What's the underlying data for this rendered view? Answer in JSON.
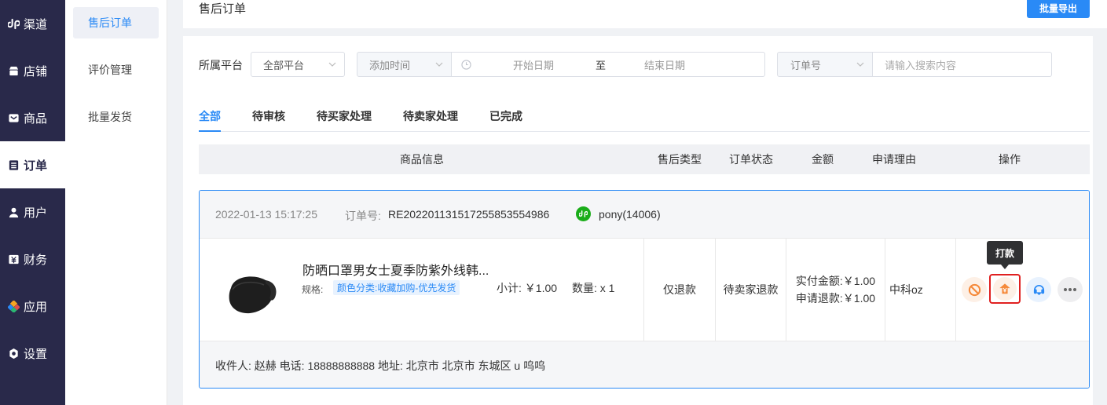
{
  "sidebar": {
    "items": [
      {
        "label": "渠道",
        "icon": "link-icon"
      },
      {
        "label": "店铺",
        "icon": "shop-icon"
      },
      {
        "label": "商品",
        "icon": "goods-icon"
      },
      {
        "label": "订单",
        "icon": "order-icon"
      },
      {
        "label": "用户",
        "icon": "user-icon"
      },
      {
        "label": "财务",
        "icon": "finance-icon"
      },
      {
        "label": "应用",
        "icon": "apps-icon"
      },
      {
        "label": "设置",
        "icon": "settings-icon"
      }
    ],
    "active": "订单"
  },
  "submenu": {
    "items": [
      {
        "label": "售后订单"
      },
      {
        "label": "评价管理"
      },
      {
        "label": "批量发货"
      }
    ],
    "active": "售后订单"
  },
  "header": {
    "title": "售后订单",
    "export_label": "批量导出"
  },
  "filters": {
    "platform_label": "所属平台",
    "platform_value": "全部平台",
    "time_type": "添加时间",
    "start_placeholder": "开始日期",
    "range_sep": "至",
    "end_placeholder": "结束日期",
    "search_type": "订单号",
    "search_placeholder": "请输入搜索内容"
  },
  "tabs": [
    {
      "label": "全部"
    },
    {
      "label": "待审核"
    },
    {
      "label": "待买家处理"
    },
    {
      "label": "待卖家处理"
    },
    {
      "label": "已完成"
    }
  ],
  "active_tab": "全部",
  "table": {
    "columns": [
      "商品信息",
      "售后类型",
      "订单状态",
      "金额",
      "申请理由",
      "操作"
    ]
  },
  "order": {
    "time": "2022-01-13 15:17:25",
    "order_no_label": "订单号:",
    "order_no": "RE20220113151725585355​4986",
    "buyer": "pony(14006)",
    "product_name": "防晒口罩男女士夏季防紫外线韩...",
    "spec_label": "规格:",
    "spec_value": "颜色分类:收藏加购-优先发货",
    "subtotal": "小计: ￥1.00",
    "quantity": "数量: x 1",
    "aftersale_type": "仅退款",
    "status": "待卖家退款",
    "paid_amount": "实付金额:￥1.00",
    "refund_amount": "申请退款:￥1.00",
    "reason": "中科oz",
    "receiver": "收件人: 赵赫 电话: 18888888888 地址: 北京市 北京市 东城区 u 呜呜"
  },
  "actions": {
    "tooltip": "打款",
    "icons": [
      "forbid-icon",
      "refund-pay-icon",
      "service-icon",
      "more-icon"
    ]
  },
  "colors": {
    "sidebar_bg": "#29294a",
    "accent": "#2a8af6",
    "orange": "#f5893a",
    "wechat_green": "#1aad19",
    "highlight_red": "#e02020"
  }
}
